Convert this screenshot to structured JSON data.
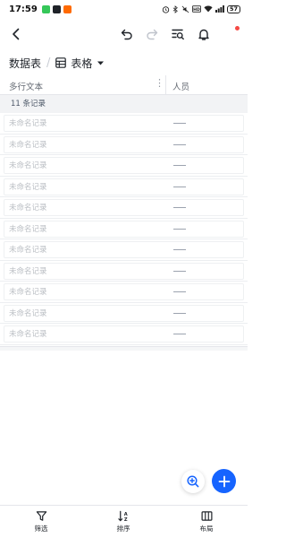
{
  "status_bar": {
    "time": "17:59",
    "battery": "57",
    "app_icons": [
      "#35c759",
      "#1f2329",
      "#ff6a00"
    ]
  },
  "toolbar": {
    "icons": [
      "back-icon",
      "undo-icon",
      "redo-icon",
      "search-list-icon",
      "bell-icon"
    ],
    "notification_dot_color": "#f54a45"
  },
  "header": {
    "breadcrumb": "数据表",
    "separator": "/",
    "view_name": "表格"
  },
  "table": {
    "columns": [
      "多行文本",
      "人员"
    ],
    "column_menu_glyph": "⋮",
    "group_label": "11 条记录",
    "rows": [
      {
        "title": "未命名记录"
      },
      {
        "title": "未命名记录"
      },
      {
        "title": "未命名记录"
      },
      {
        "title": "未命名记录"
      },
      {
        "title": "未命名记录"
      },
      {
        "title": "未命名记录"
      },
      {
        "title": "未命名记录"
      },
      {
        "title": "未命名记录"
      },
      {
        "title": "未命名记录"
      },
      {
        "title": "未命名记录"
      },
      {
        "title": "未命名记录"
      }
    ]
  },
  "fab": {
    "accent_color": "#1664ff"
  },
  "bottom_bar": {
    "filter_label": "筛选",
    "sort_label": "排序",
    "layout_label": "布局"
  }
}
